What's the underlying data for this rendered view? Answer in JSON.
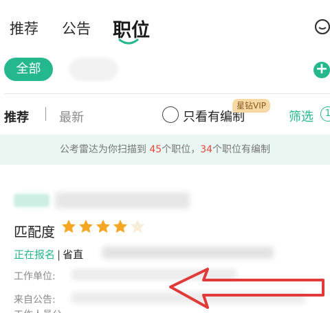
{
  "tabs": [
    {
      "label": "推荐"
    },
    {
      "label": "公告"
    },
    {
      "label": "职位"
    }
  ],
  "filters": {
    "all_chip": "全部"
  },
  "sort": {
    "recommend": "推荐",
    "latest": "最新",
    "only_with_staff": "只看有编制",
    "vip_badge": "星钻VIP",
    "filter_label": "筛选",
    "filter_count": "1"
  },
  "banner": {
    "prefix": "公考雷达为你扫描到 ",
    "total": "45",
    "middle": "个职位，",
    "with_staff": "34",
    "suffix": "个职位有编制"
  },
  "card": {
    "match_label": "匹配度",
    "rating_stars": 4,
    "rating_max": 5,
    "status": "正在报名",
    "status_sep": "|",
    "level": "省直",
    "unit_label": "工作单位:",
    "source_label": "来自公告:",
    "staff_label": "工作人员公"
  },
  "colors": {
    "accent": "#25b88e",
    "highlight": "#e8473c",
    "star": "#f5a623",
    "arrow": "#e03a3a"
  }
}
